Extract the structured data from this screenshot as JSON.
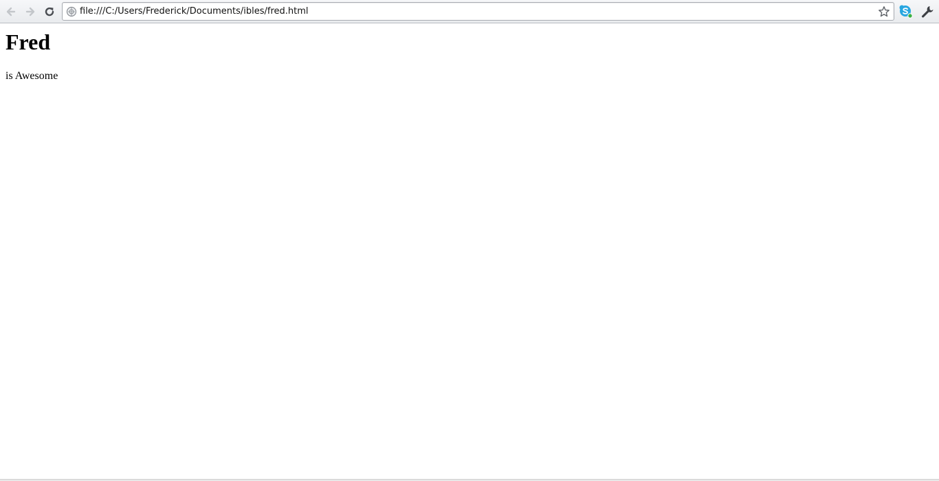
{
  "browser": {
    "address_bar": {
      "url": "file:///C:/Users/Frederick/Documents/ibles/fred.html"
    },
    "icons": {
      "back": "back-arrow-icon",
      "forward": "forward-arrow-icon",
      "reload": "reload-icon",
      "page": "globe-icon",
      "bookmark": "star-icon",
      "extension": "skype-icon",
      "menu": "wrench-icon"
    }
  },
  "page": {
    "heading": "Fred",
    "paragraph": "is Awesome"
  }
}
